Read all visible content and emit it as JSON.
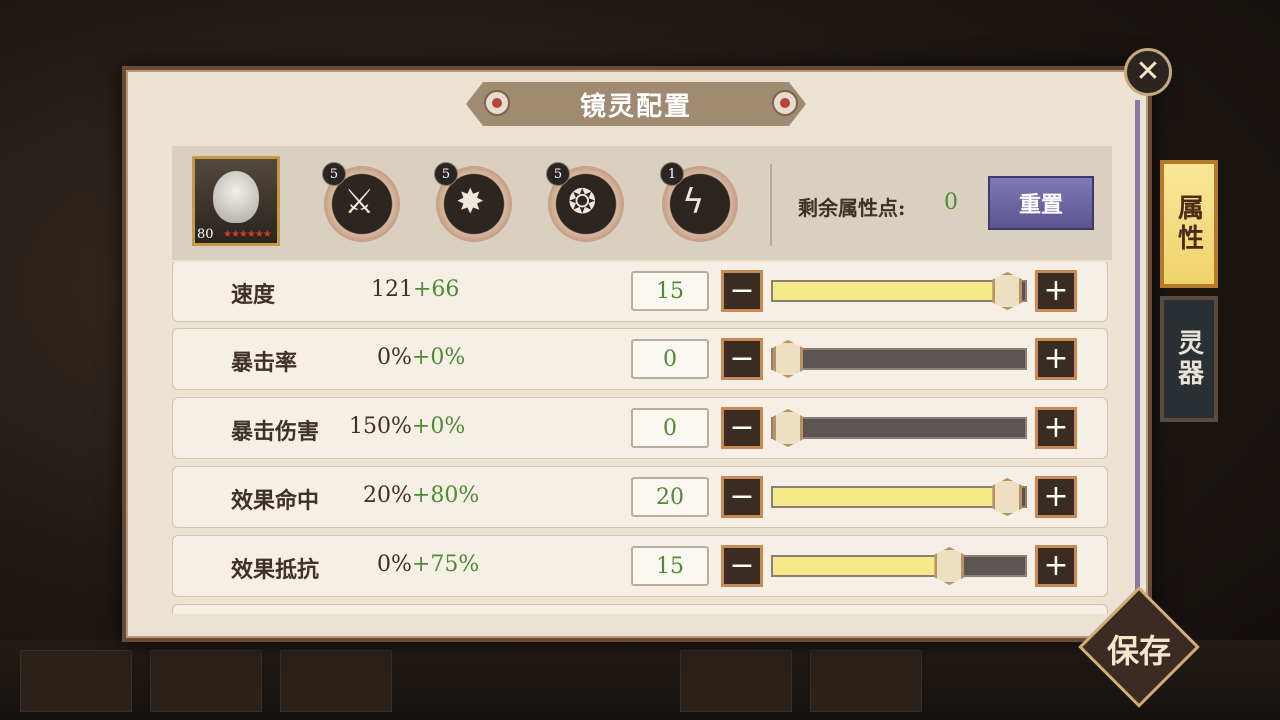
{
  "dialog": {
    "title": "镜灵配置",
    "close_icon": "close-icon"
  },
  "hero": {
    "level": "80",
    "stars": "★★★★★★"
  },
  "skills": [
    {
      "level": "5",
      "icon": "sword-slash-icon",
      "glyph": "⚔"
    },
    {
      "level": "5",
      "icon": "claw-burst-icon",
      "glyph": "✸"
    },
    {
      "level": "5",
      "icon": "vortex-icon",
      "glyph": "❂"
    },
    {
      "level": "1",
      "icon": "lightning-sword-icon",
      "glyph": "ϟ"
    }
  ],
  "points": {
    "label": "剩余属性点:",
    "value": "0"
  },
  "reset_label": "重置",
  "stats": [
    {
      "name": "速度",
      "base": "121",
      "bonus": "+66",
      "points": "15",
      "level": 0.93
    },
    {
      "name": "暴击率",
      "base": "0%",
      "bonus": "+0%",
      "points": "0",
      "level": 0
    },
    {
      "name": "暴击伤害",
      "base": "150%",
      "bonus": "+0%",
      "points": "0",
      "level": 0
    },
    {
      "name": "效果命中",
      "base": "20%",
      "bonus": "+80%",
      "points": "20",
      "level": 0.93
    },
    {
      "name": "效果抵抗",
      "base": "0%",
      "bonus": "+75%",
      "points": "15",
      "level": 0.7
    }
  ],
  "buttons": {
    "minus": "−",
    "plus": "+"
  },
  "tabs": {
    "attributes": "属性",
    "spirit": "灵器"
  },
  "save_label": "保存",
  "colors": {
    "bonus_green": "#4f8a34",
    "slider_fill": "#f5e98a",
    "reset_purple": "#6c66a4"
  }
}
